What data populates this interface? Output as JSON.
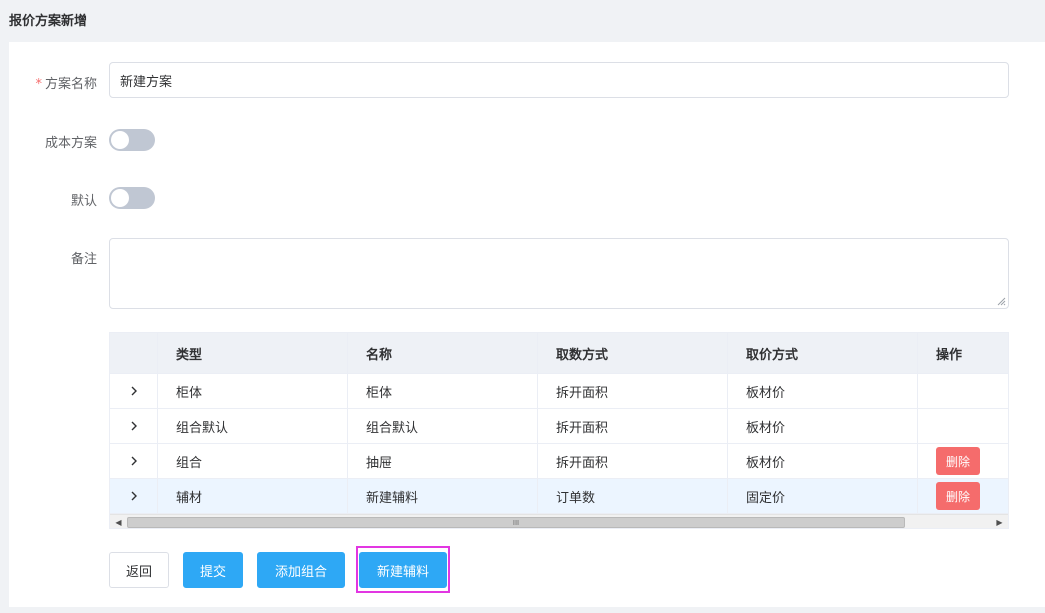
{
  "page": {
    "title": "报价方案新增"
  },
  "form": {
    "name_label": "方案名称",
    "required_mark": "*",
    "name_value": "新建方案",
    "cost_label": "成本方案",
    "default_label": "默认",
    "remark_label": "备注",
    "remark_value": ""
  },
  "table": {
    "headers": [
      "类型",
      "名称",
      "取数方式",
      "取价方式",
      "操作"
    ],
    "rows": [
      {
        "type": "柜体",
        "name": "柜体",
        "fetch": "拆开面积",
        "price": "板材价",
        "action": ""
      },
      {
        "type": "组合默认",
        "name": "组合默认",
        "fetch": "拆开面积",
        "price": "板材价",
        "action": ""
      },
      {
        "type": "组合",
        "name": "抽屉",
        "fetch": "拆开面积",
        "price": "板材价",
        "action": "删除"
      },
      {
        "type": "辅材",
        "name": "新建辅料",
        "fetch": "订单数",
        "price": "固定价",
        "action": "删除"
      }
    ],
    "scroll_grip": "III"
  },
  "buttons": {
    "back": "返回",
    "submit": "提交",
    "add_group": "添加组合",
    "new_aux": "新建辅料"
  },
  "colors": {
    "primary": "#2ea8f5",
    "danger": "#f56c6c",
    "highlight": "#e236e2"
  }
}
